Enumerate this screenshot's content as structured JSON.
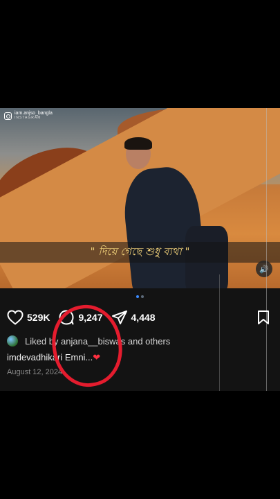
{
  "watermark": {
    "handle": "iam.anjso_bangla",
    "platform": "INSTAGRAM"
  },
  "post": {
    "caption_overlay": "\" দিয়ে গেছে শুধু ব্যথা \"",
    "carousel": {
      "total": 2,
      "active": 1
    },
    "actions": {
      "likes": "529K",
      "comments": "9,247",
      "shares": "4,448"
    },
    "liked_by": "Liked by anjana__biswas and others",
    "caption": "imdevadhikari Emni...",
    "date": "August 12, 2024"
  },
  "colors": {
    "accent_blue": "#3b8bff",
    "highlight_red": "#e41c2e",
    "caption_gold": "#f2d27a"
  },
  "icons": [
    "heart-icon",
    "comment-icon",
    "share-icon",
    "bookmark-icon",
    "sound-icon",
    "globe-icon",
    "instagram-icon"
  ]
}
